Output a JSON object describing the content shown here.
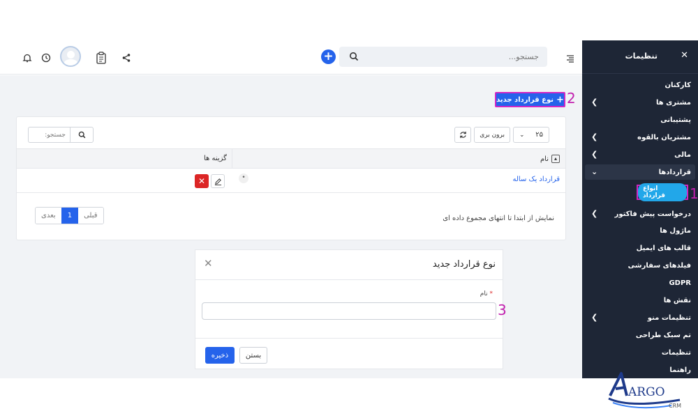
{
  "header": {
    "search_placeholder": "جستجو...",
    "icons": [
      "bell-icon",
      "clock-icon",
      "avatar",
      "clipboard-icon",
      "share-icon",
      "plus-circle-icon",
      "search-icon",
      "menu-toggle-icon"
    ]
  },
  "main": {
    "new_button_label": "نوع قرارداد جدید",
    "annotations": [
      "1",
      "2",
      "3"
    ],
    "table": {
      "page_size": "۲۵",
      "export_label": "برون بری",
      "search_placeholder": "جستجو:",
      "columns": [
        "نام",
        "گزینه ها"
      ],
      "rows": [
        {
          "name": "قرارداد یک ساله",
          "dot": "•"
        }
      ],
      "info_text": "نمایش از ابتدا تا انتهای مجموع داده ای",
      "pager": {
        "prev": "قبلی",
        "current": "1",
        "next": "بعدی"
      }
    }
  },
  "modal": {
    "title": "نوع قرارداد جدید",
    "field_label": "نام",
    "required_mark": "*",
    "save_label": "ذخیره",
    "close_label": "بستن"
  },
  "sidebar": {
    "title": "تنظیمات",
    "items": [
      {
        "label": "کارکنان",
        "chevron": false
      },
      {
        "label": "مشتری ها",
        "chevron": true
      },
      {
        "label": "پشتیبانی",
        "chevron": false
      },
      {
        "label": "مشتریان بالقوه",
        "chevron": true
      },
      {
        "label": "مالی",
        "chevron": true
      },
      {
        "label": "قراردادها",
        "chevron": true
      },
      {
        "label": "درخواست پیش فاکتور",
        "chevron": true
      },
      {
        "label": "ماژول ها",
        "chevron": false
      },
      {
        "label": "قالب های ایمیل",
        "chevron": false
      },
      {
        "label": "فیلدهای سفارشی",
        "chevron": false
      },
      {
        "label": "GDPR",
        "chevron": false
      },
      {
        "label": "نقش ها",
        "chevron": false
      },
      {
        "label": "تنظیمات منو",
        "chevron": true
      },
      {
        "label": "تم سبک طراحی",
        "chevron": false
      },
      {
        "label": "تنظیمات",
        "chevron": false
      },
      {
        "label": "راهنما",
        "chevron": false
      }
    ],
    "active_subitem": "انواع قرارداد"
  },
  "logo": {
    "text": "ARGO",
    "sub": "CRM"
  },
  "colors": {
    "primary": "#2563eb",
    "sidebar_bg": "#1e2636",
    "highlight": "#d226c4",
    "danger": "#dc2626",
    "pill": "#22a7e9"
  }
}
